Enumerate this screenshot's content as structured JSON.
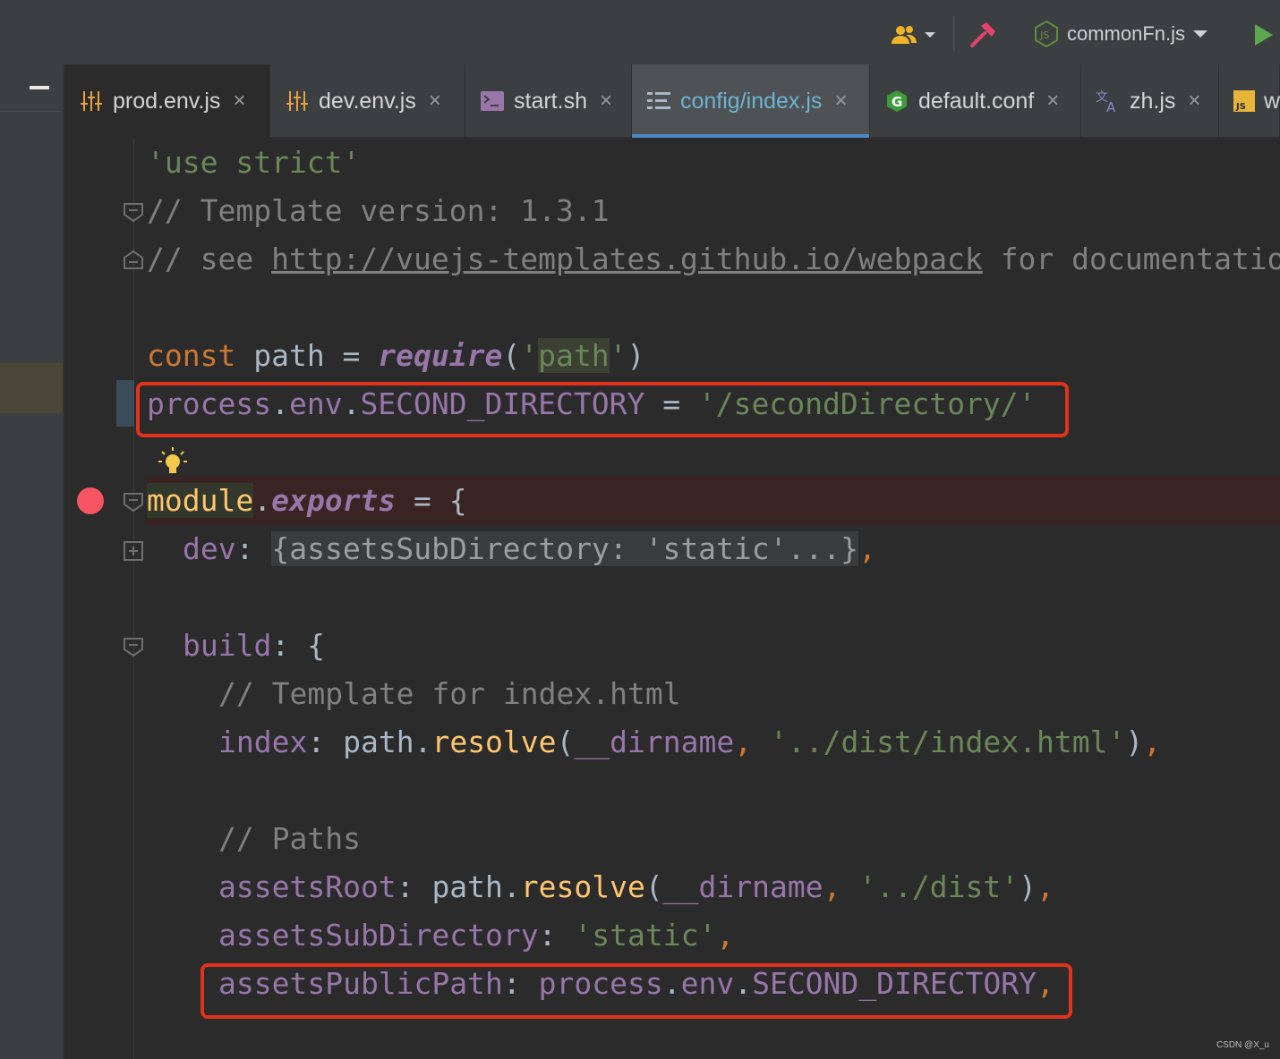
{
  "toolbar": {
    "users_icon": "users-icon",
    "build_icon": "hammer-icon",
    "run_config": "commonFn.js",
    "run_icon": "play-icon"
  },
  "tabs": [
    {
      "label": "prod.env.js",
      "icon": "config-sliders-icon",
      "close": "×"
    },
    {
      "label": "dev.env.js",
      "icon": "config-sliders-icon",
      "close": "×"
    },
    {
      "label": "start.sh",
      "icon": "terminal-icon",
      "close": "×"
    },
    {
      "label": "config/index.js",
      "icon": "structure-icon",
      "close": "×",
      "active": true
    },
    {
      "label": "default.conf",
      "icon": "nginx-icon",
      "close": "×"
    },
    {
      "label": "zh.js",
      "icon": "translate-icon",
      "close": "×"
    },
    {
      "label": "w",
      "icon": "js-file-icon"
    }
  ],
  "code": {
    "l1": "'use strict'",
    "l2": "// Template version: 1.3.1",
    "l3_prefix": "// see ",
    "l3_link": "http://vuejs-templates.github.io/webpack",
    "l3_suffix": " for documentation",
    "l5": {
      "kw": "const",
      "name": " path = ",
      "fn": "require",
      "open": "(",
      "q1": "'",
      "arg": "path",
      "q2": "'",
      "close": ")"
    },
    "l6": {
      "obj": "process",
      "dot1": ".",
      "env": "env",
      "dot2": ".",
      "key": "SECOND_DIRECTORY",
      "eq": " = ",
      "val": "'/secondDirectory/'"
    },
    "l8": {
      "module": "module",
      "dot": ".",
      "exports": "exports",
      "rest": " = {"
    },
    "l9": {
      "key": "dev",
      "colon": ": ",
      "folded": "{assetsSubDirectory: 'static'...}",
      "comma": ","
    },
    "l11": {
      "key": "build",
      "rest": ": {"
    },
    "l12": "// Template for index.html",
    "l13": {
      "key": "index",
      "colon": ": ",
      "obj": "path",
      "dot": ".",
      "fn": "resolve",
      "open": "(",
      "dirname": "__dirname",
      "comma": ", ",
      "str": "'../dist/index.html'",
      "close": ")",
      "end": ","
    },
    "l15": "// Paths",
    "l16": {
      "key": "assetsRoot",
      "colon": ": ",
      "obj": "path",
      "dot": ".",
      "fn": "resolve",
      "open": "(",
      "dirname": "__dirname",
      "comma": ", ",
      "str": "'../dist'",
      "close": ")",
      "end": ","
    },
    "l17": {
      "key": "assetsSubDirectory",
      "colon": ": ",
      "str": "'static'",
      "end": ","
    },
    "l18": {
      "key": "assetsPublicPath",
      "colon": ": ",
      "obj": "process",
      "dot1": ".",
      "env": "env",
      "dot2": ".",
      "key2": "SECOND_DIRECTORY",
      "end": ","
    }
  },
  "watermark": "CSDN @X_u",
  "colors": {
    "string": "#6a8759",
    "comment": "#808080",
    "keyword": "#cc7832",
    "property": "#9876aa",
    "function": "#ffc66d",
    "highlight_box": "#e3321b",
    "breakpoint": "#f75464"
  }
}
